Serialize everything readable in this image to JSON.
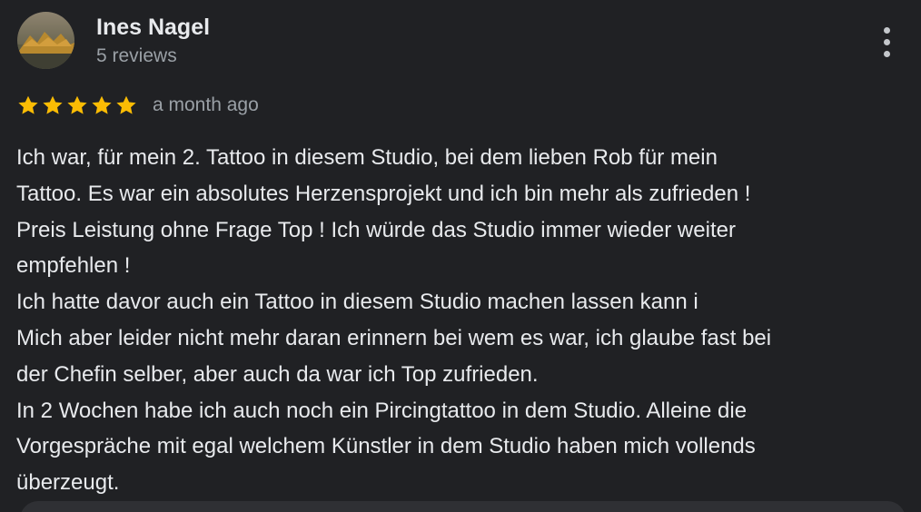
{
  "review": {
    "author": {
      "name": "Ines Nagel",
      "meta": "5 reviews",
      "avatar_icon": "avatar-photo"
    },
    "rating": {
      "stars": 5,
      "max": 5,
      "star_color": "#fbbc04"
    },
    "time": "a month ago",
    "more_icon": "more-vert-icon",
    "text_lines": [
      "Ich war, für mein 2. Tattoo in diesem Studio, bei dem lieben Rob für mein",
      "Tattoo. Es war ein absolutes Herzensprojekt und ich bin mehr als zufrieden !",
      "Preis Leistung ohne Frage Top ! Ich würde das Studio immer wieder weiter",
      "empfehlen !",
      "Ich hatte davor auch ein Tattoo in diesem Studio machen lassen kann i",
      "Mich aber leider nicht mehr daran erinnern bei wem es war, ich glaube fast bei",
      "der Chefin selber, aber auch da war ich Top zufrieden.",
      "In 2 Wochen habe ich auch noch ein Pircingtattoo in dem Studio. Alleine die",
      "Vorgespräche mit egal welchem Künstler in dem Studio haben mich vollends",
      "überzeugt."
    ]
  },
  "colors": {
    "background": "#202124",
    "text_primary": "#e8eaed",
    "text_secondary": "#9aa0a6"
  }
}
